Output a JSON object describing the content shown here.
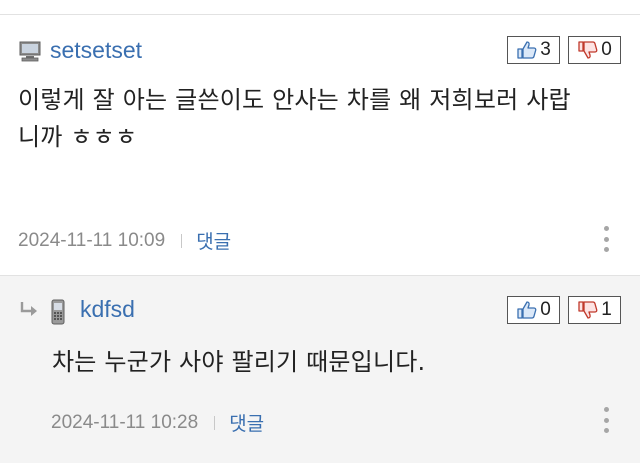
{
  "comments": [
    {
      "author": "setsetset",
      "author_icon": "computer-icon",
      "upvotes": "3",
      "downvotes": "0",
      "body_line1": "이렇게 잘 아는 글쓴이도 안사는 차를 왜 저희보러 사랍",
      "body_line2": "니까 ㅎㅎㅎ",
      "timestamp": "2024-11-11 10:09",
      "reply_label": "댓글"
    },
    {
      "author": "kdfsd",
      "author_icon": "mobile-phone-icon",
      "upvotes": "0",
      "downvotes": "1",
      "body_line1": "차는 누군가 사야 팔리기 때문입니다.",
      "timestamp": "2024-11-11 10:28",
      "reply_label": "댓글"
    }
  ],
  "colors": {
    "author": "#3a6fb0",
    "link": "#3a6fb0",
    "meta": "#8a8a8a",
    "reply_bg": "#f4f4f4"
  }
}
